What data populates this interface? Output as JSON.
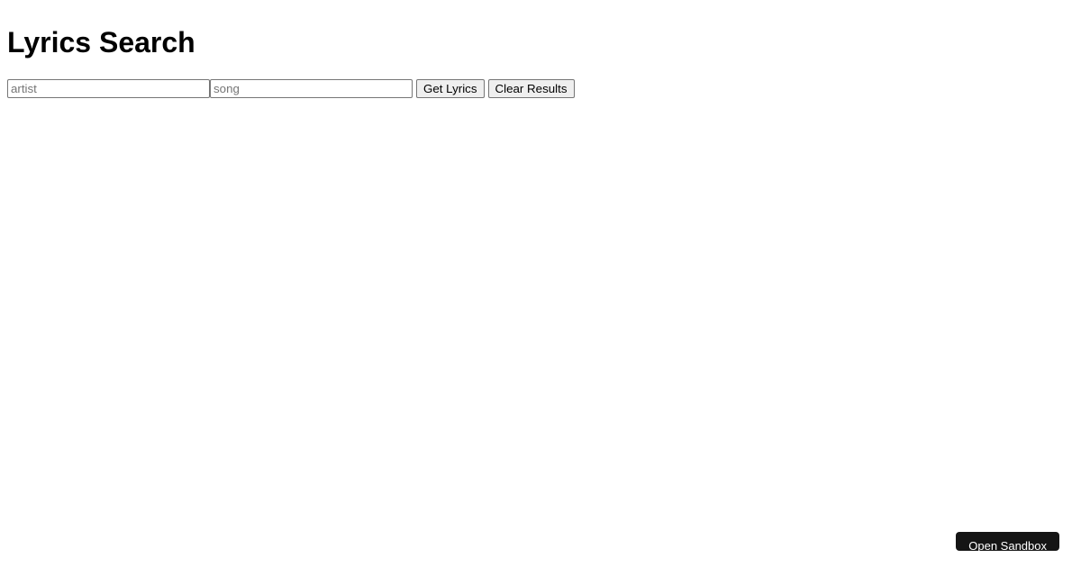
{
  "title": "Lyrics Search",
  "form": {
    "artist_placeholder": "artist",
    "artist_value": "",
    "song_placeholder": "song",
    "song_value": "",
    "get_lyrics_label": "Get Lyrics",
    "clear_results_label": "Clear Results"
  },
  "sandbox_button_label": "Open Sandbox"
}
